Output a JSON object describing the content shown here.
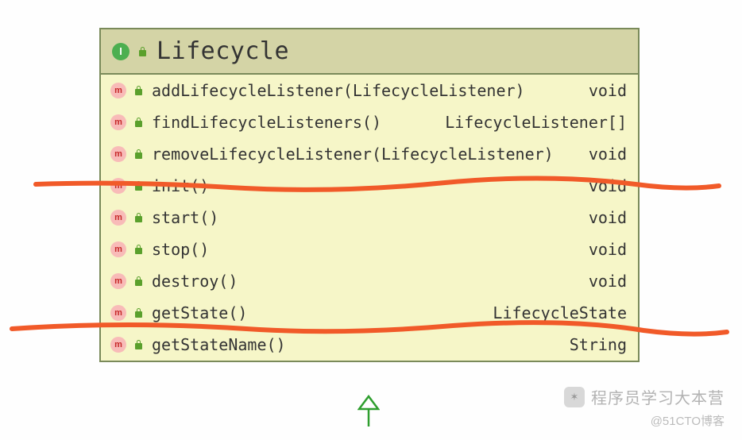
{
  "class": {
    "icon": "I",
    "name": "Lifecycle"
  },
  "methods": [
    {
      "icon": "m",
      "name": "addLifecycleListener(LifecycleListener)",
      "ret": "void"
    },
    {
      "icon": "m",
      "name": "findLifecycleListeners()",
      "ret": "LifecycleListener[]"
    },
    {
      "icon": "m",
      "name": "removeLifecycleListener(LifecycleListener)",
      "ret": "void"
    },
    {
      "icon": "m",
      "name": "init()",
      "ret": "void"
    },
    {
      "icon": "m",
      "name": "start()",
      "ret": "void"
    },
    {
      "icon": "m",
      "name": "stop()",
      "ret": "void"
    },
    {
      "icon": "m",
      "name": "destroy()",
      "ret": "void"
    },
    {
      "icon": "m",
      "name": "getState()",
      "ret": "LifecycleState"
    },
    {
      "icon": "m",
      "name": "getStateName()",
      "ret": "String"
    }
  ],
  "annotations": {
    "divider1_after_index": 2,
    "divider2_after_index": 6,
    "color": "#f15a29"
  },
  "arrow": {
    "color": "#2e9e2e"
  },
  "watermark_main": "程序员学习大本营",
  "watermark_sub": "@51CTO博客"
}
